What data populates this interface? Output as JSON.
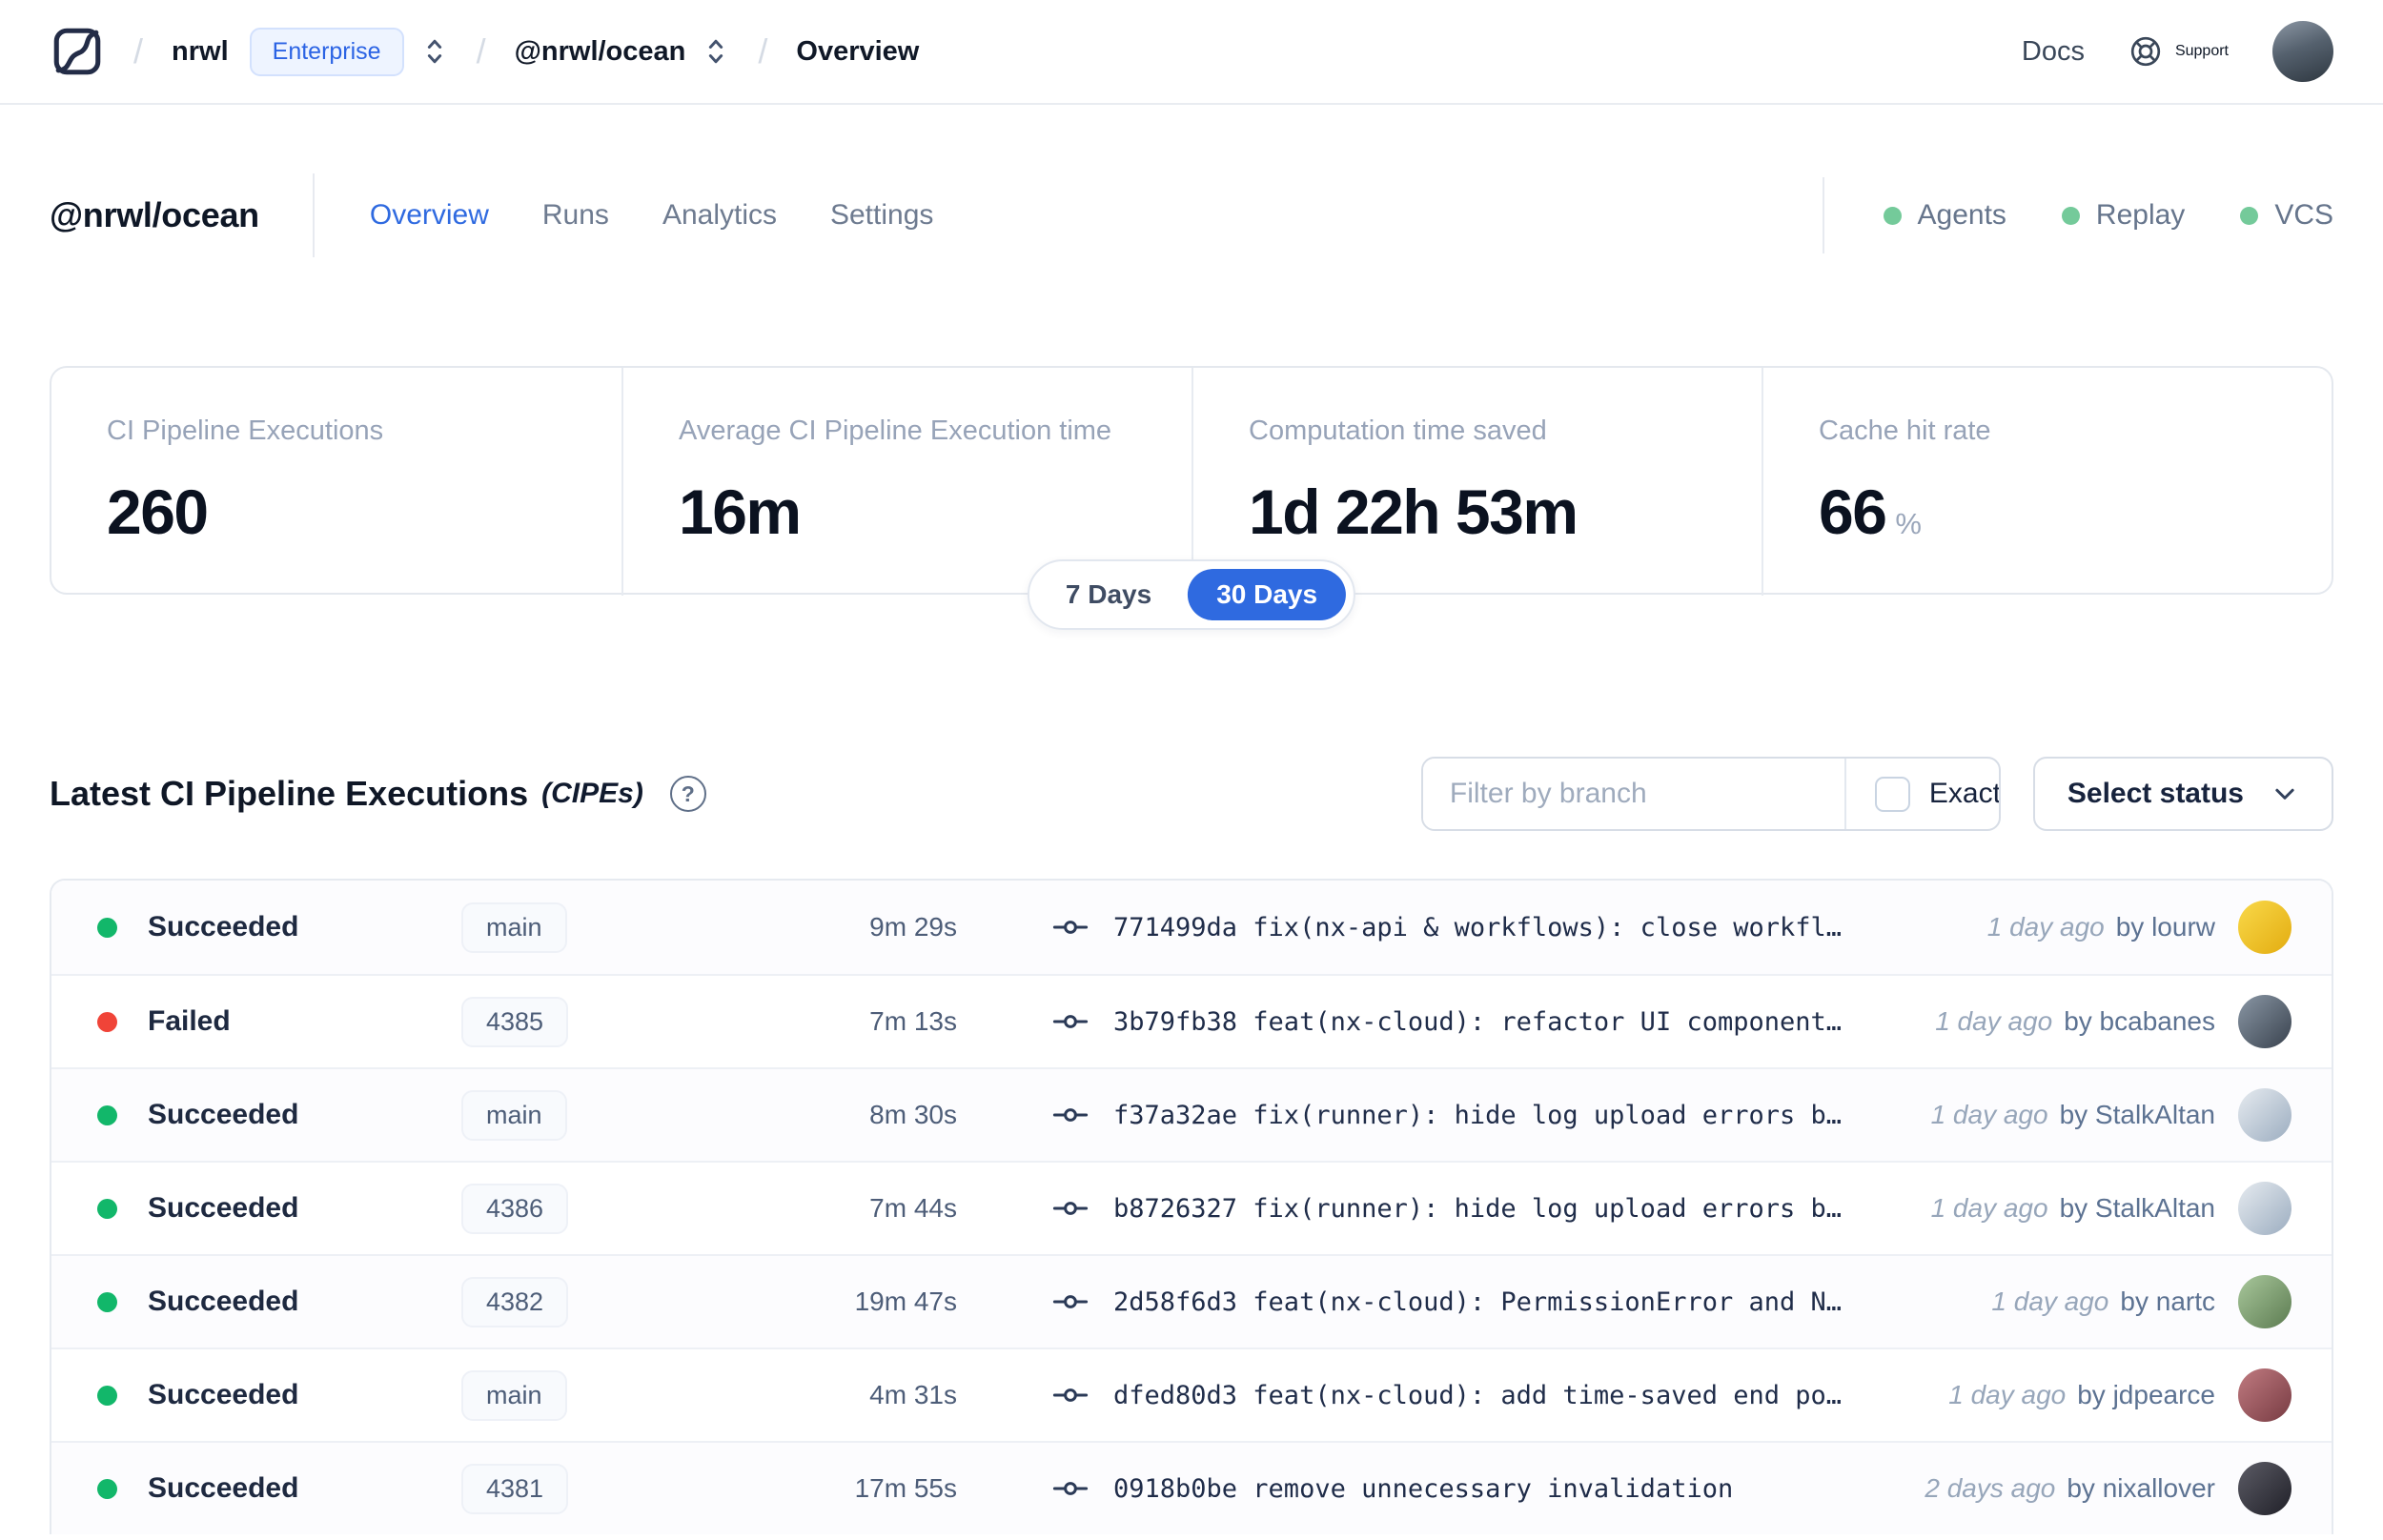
{
  "nav": {
    "breadcrumb": {
      "separator": "/",
      "org": "nrwl",
      "org_badge": "Enterprise",
      "workspace": "@nrwl/ocean",
      "page": "Overview"
    },
    "docs_label": "Docs",
    "support_label": "Support"
  },
  "header": {
    "title": "@nrwl/ocean",
    "tabs": [
      {
        "label": "Overview",
        "active": true
      },
      {
        "label": "Runs",
        "active": false
      },
      {
        "label": "Analytics",
        "active": false
      },
      {
        "label": "Settings",
        "active": false
      }
    ],
    "indicators": [
      {
        "label": "Agents",
        "color": "#74ca9a"
      },
      {
        "label": "Replay",
        "color": "#74ca9a"
      },
      {
        "label": "VCS",
        "color": "#74ca9a"
      }
    ]
  },
  "stats": {
    "cards": [
      {
        "label": "CI Pipeline Executions",
        "value": "260",
        "suffix": ""
      },
      {
        "label": "Average CI Pipeline Execution time",
        "value": "16m",
        "suffix": ""
      },
      {
        "label": "Computation time saved",
        "value": "1d 22h 53m",
        "suffix": ""
      },
      {
        "label": "Cache hit rate",
        "value": "66",
        "suffix": "%"
      }
    ],
    "range": {
      "options": [
        "7 Days",
        "30 Days"
      ],
      "selected": "30 Days"
    }
  },
  "cipes": {
    "title": "Latest CI Pipeline Executions",
    "title_suffix": "(CIPEs)",
    "help_icon": "?",
    "filter": {
      "placeholder": "Filter by branch",
      "exact_label": "Exact",
      "exact_checked": false
    },
    "status_select_label": "Select status"
  },
  "table": {
    "rows": [
      {
        "status": "Succeeded",
        "dot_color": "#12b76a",
        "branch": "main",
        "duration": "9m 29s",
        "commit": "771499da fix(nx-api & workflows): close workfl…",
        "time": "1 day ago",
        "author": "by lourw",
        "avatar_bg": "linear-gradient(135deg,#f9d94a,#e3ac10)"
      },
      {
        "status": "Failed",
        "dot_color": "#f04438",
        "branch": "4385",
        "duration": "7m 13s",
        "commit": "3b79fb38 feat(nx-cloud): refactor UI component…",
        "time": "1 day ago",
        "author": "by bcabanes",
        "avatar_bg": "linear-gradient(135deg,#8a97a5,#39424e)"
      },
      {
        "status": "Succeeded",
        "dot_color": "#12b76a",
        "branch": "main",
        "duration": "8m 30s",
        "commit": "f37a32ae fix(runner): hide log upload errors b…",
        "time": "1 day ago",
        "author": "by StalkAltan",
        "avatar_bg": "linear-gradient(135deg,#e6ebf0,#9cadc0)"
      },
      {
        "status": "Succeeded",
        "dot_color": "#12b76a",
        "branch": "4386",
        "duration": "7m 44s",
        "commit": "b8726327 fix(runner): hide log upload errors b…",
        "time": "1 day ago",
        "author": "by StalkAltan",
        "avatar_bg": "linear-gradient(135deg,#e6ebf0,#9cadc0)"
      },
      {
        "status": "Succeeded",
        "dot_color": "#12b76a",
        "branch": "4382",
        "duration": "19m 47s",
        "commit": "2d58f6d3 feat(nx-cloud): PermissionError and N…",
        "time": "1 day ago",
        "author": "by nartc",
        "avatar_bg": "linear-gradient(135deg,#a9c89c,#5c7b51)"
      },
      {
        "status": "Succeeded",
        "dot_color": "#12b76a",
        "branch": "main",
        "duration": "4m 31s",
        "commit": "dfed80d3 feat(nx-cloud): add time-saved end po…",
        "time": "1 day ago",
        "author": "by jdpearce",
        "avatar_bg": "linear-gradient(135deg,#c17b81,#773b42)"
      },
      {
        "status": "Succeeded",
        "dot_color": "#12b76a",
        "branch": "4381",
        "duration": "17m 55s",
        "commit": "0918b0be remove unnecessary invalidation",
        "time": "2 days ago",
        "author": "by nixallover",
        "avatar_bg": "linear-gradient(135deg,#5c5c66,#202028)"
      }
    ]
  }
}
